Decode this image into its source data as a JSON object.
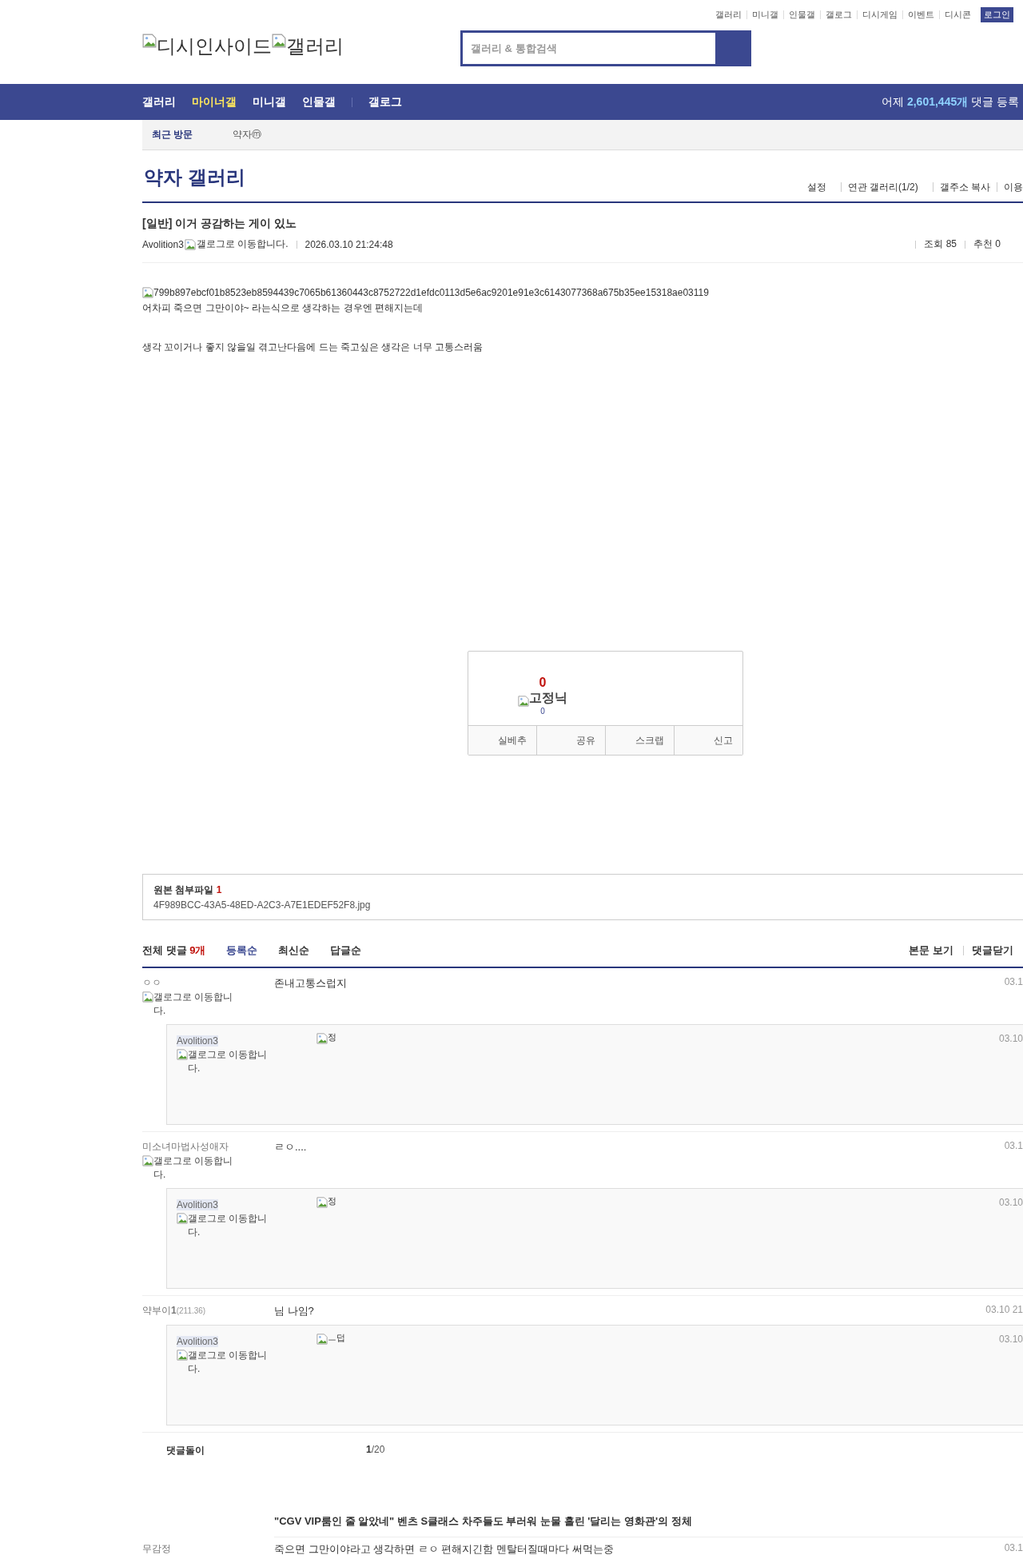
{
  "top_links": [
    "갤러리",
    "미니갤",
    "인물갤",
    "갤로그",
    "디시게임",
    "이벤트",
    "디시콘"
  ],
  "login_button": "로그인",
  "logo": {
    "alt_1": "디시인사이드",
    "alt_2": "갤러리"
  },
  "search": {
    "placeholder": "갤러리 & 통합검색"
  },
  "nav": {
    "items": [
      {
        "label": "갤러리",
        "selected": false
      },
      {
        "label": "마이너갤",
        "selected": true
      },
      {
        "label": "미니갤",
        "selected": false
      },
      {
        "label": "인물갤",
        "selected": false
      }
    ],
    "gallog": "갤로그",
    "stats": {
      "prefix": "어제",
      "count": "2,601,445개",
      "suffix": "댓글 등록"
    }
  },
  "recent": {
    "label": "최근 방문",
    "items": [
      {
        "label": "약자",
        "badge": "ⓜ"
      }
    ]
  },
  "gallery": {
    "title": "약자 갤러리",
    "links": [
      "설정",
      "연관 갤러리(1/2)",
      "갤주소 복사",
      "이용"
    ]
  },
  "post": {
    "title": "[일반] 이거 공감하는 게이 있노",
    "author": "Avolition3",
    "author_icon_alt": "갤로그로 이동합니다.",
    "date": "2026.03.10 21:24:48",
    "views": "조회 85",
    "recommends": "추천 0",
    "image_alt": "799b897ebcf01b8523eb8594439c7065b61360443c8752722d1efdc0113d5e6ac9201e91e3c6143077368a675b35ee15318ae03119",
    "paragraphs": [
      "어차피 죽으면 그만이야~ 라는식으로 생각하는 경우엔 편해지는데",
      "생각 꼬이거나 좋지 않을일 겪고난다음에 드는 죽고싶은 생각은 너무 고통스러움"
    ]
  },
  "vote": {
    "count": "0",
    "image_alt": "고정닉",
    "fixed_count": "0",
    "buttons": [
      "실베추",
      "공유",
      "스크랩",
      "신고"
    ]
  },
  "attachments": {
    "label": "원본 첨부파일",
    "count": "1",
    "files": [
      "4F989BCC-43A5-48ED-A2C3-A7E1EDEF52F8.jpg"
    ]
  },
  "comments": {
    "label": "전체 댓글",
    "count": "9개",
    "sorts": [
      {
        "label": "등록순",
        "selected": true
      },
      {
        "label": "최신순",
        "selected": false
      },
      {
        "label": "답글순",
        "selected": false
      }
    ],
    "actions": [
      "본문 보기",
      "댓글닫기"
    ],
    "items": [
      {
        "author": "ㅇㅇ",
        "author_icon_alt": "갤로그로 이동합니다.",
        "text": "존내고통스럽지",
        "date": "03.1",
        "replies": [
          {
            "author": "Avolition3",
            "author_icon_alt": "갤로그로 이동합니다.",
            "image_alt": "정",
            "date": "03.10"
          }
        ]
      },
      {
        "author": "미소녀마법사성애자",
        "author_icon_alt": "갤로그로 이동합니다.",
        "text": "ㄹㅇ....",
        "date": "03.1",
        "replies": [
          {
            "author": "Avolition3",
            "author_icon_alt": "갤로그로 이동합니다.",
            "image_alt": "정",
            "date": "03.10"
          }
        ]
      },
      {
        "author": "약부이**1**",
        "ip": "(211.36)",
        "text": "님 나임?",
        "date": "03.10 21",
        "replies": [
          {
            "author": "Avolition3",
            "author_icon_alt": "갤로그로 이동합니다.",
            "image_alt": "ㅡ덥",
            "date": "03.10"
          }
        ]
      }
    ]
  },
  "comment_bot": {
    "label": "댓글돌이",
    "page": "1",
    "total": "/20"
  },
  "ad": "\"CGV VIP룸인 줄 알았네\" 벤츠 S클래스 차주들도 부러워 눈물 흘린 '달리는 영화관'의 정체",
  "more_comments": [
    {
      "author": "무감정",
      "text": "죽으면 그만이야라고 생각하면 ㄹㅇ 편해지긴함 멘탈터질때마다 써먹는중",
      "date": "03.1"
    }
  ]
}
